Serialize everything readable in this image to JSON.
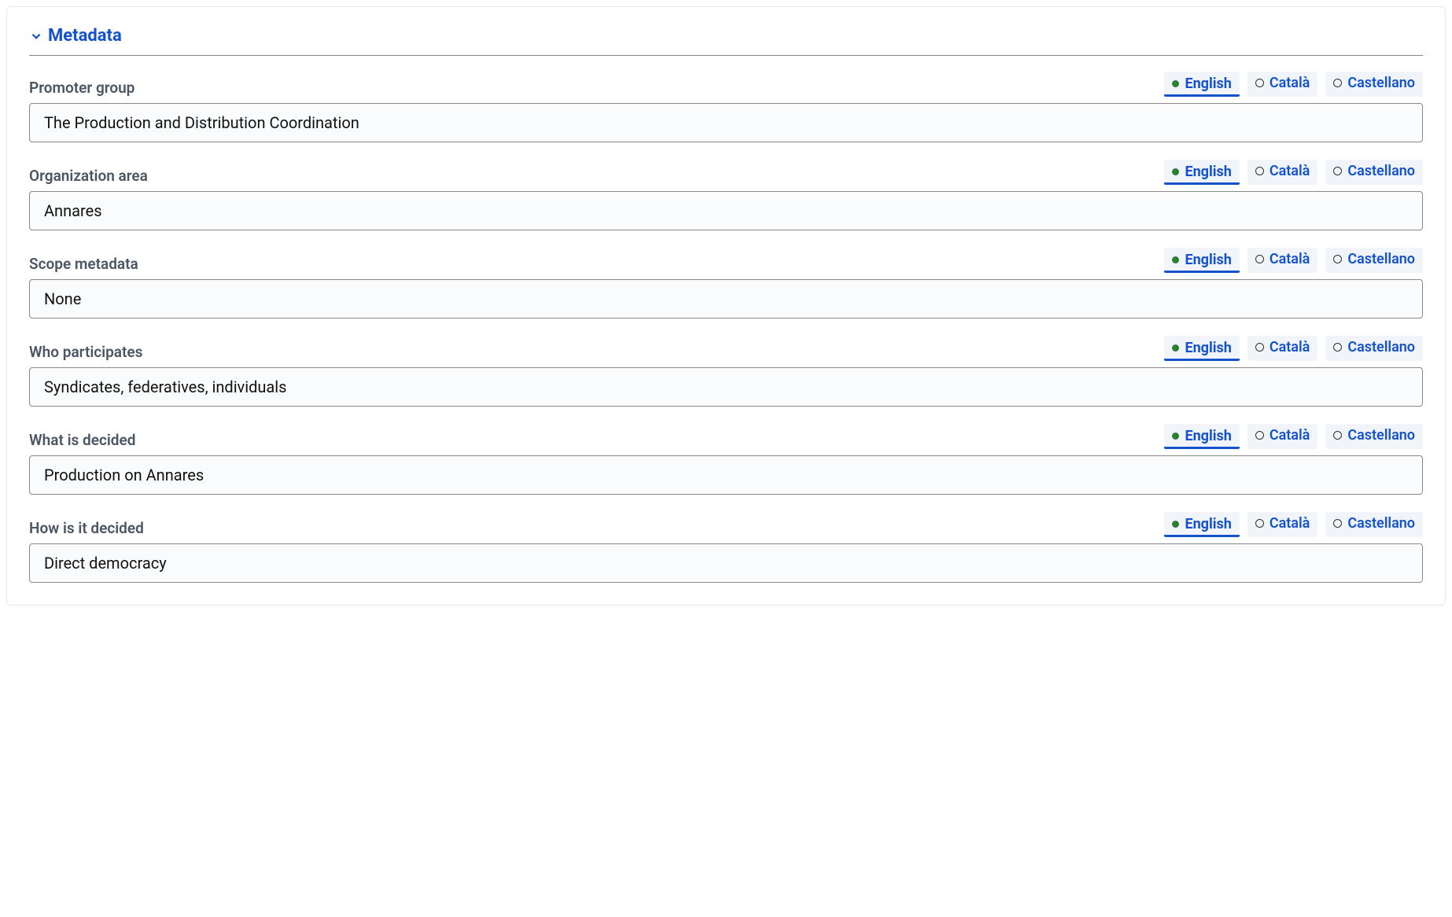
{
  "section": {
    "title": "Metadata"
  },
  "languages": {
    "english": "English",
    "catala": "Català",
    "castellano": "Castellano"
  },
  "fields": {
    "promoter_group": {
      "label": "Promoter group",
      "value": "The Production and Distribution Coordination"
    },
    "organization_area": {
      "label": "Organization area",
      "value": "Annares"
    },
    "scope_metadata": {
      "label": "Scope metadata",
      "value": "None"
    },
    "who_participates": {
      "label": "Who participates",
      "value": "Syndicates, federatives, individuals"
    },
    "what_is_decided": {
      "label": "What is decided",
      "value": "Production on Annares"
    },
    "how_is_it_decided": {
      "label": "How is it decided",
      "value": "Direct democracy"
    }
  }
}
